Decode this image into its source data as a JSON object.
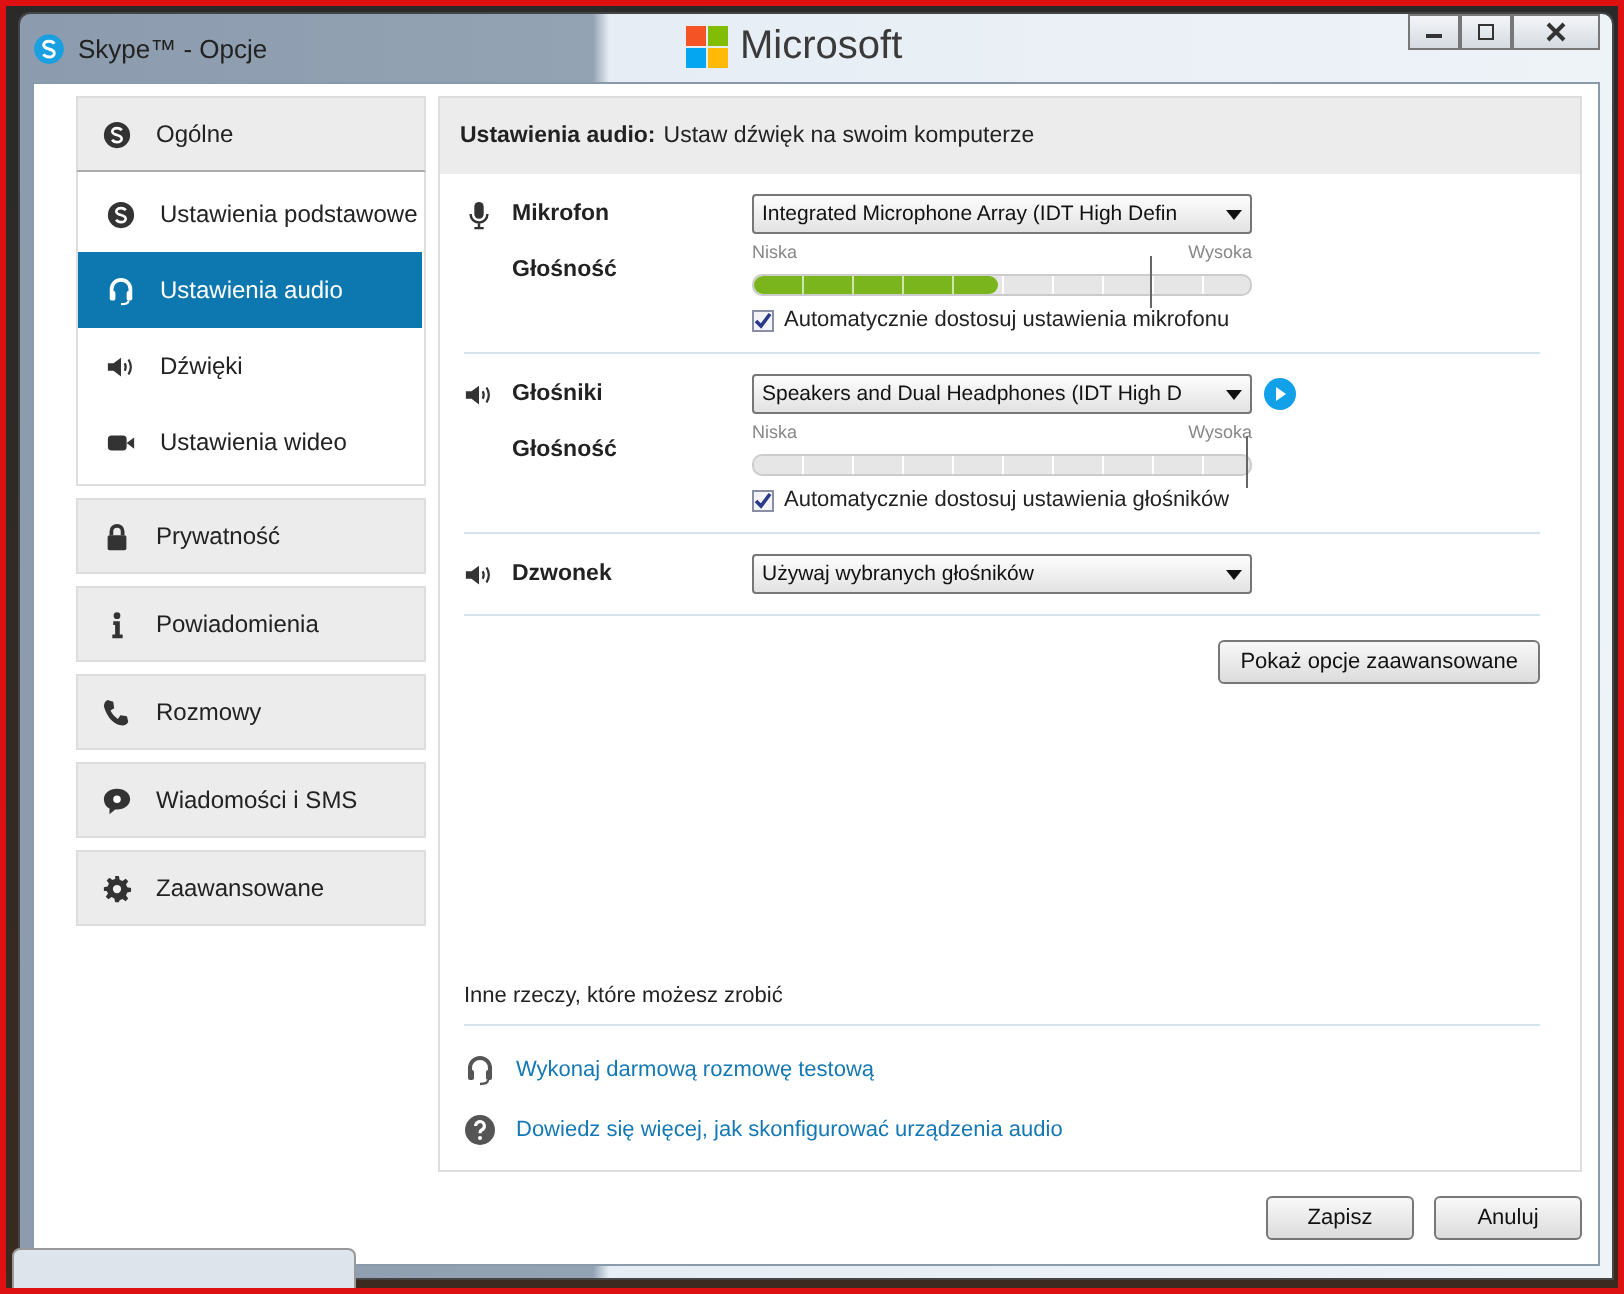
{
  "backdrop": {
    "logo_text": "Microsoft"
  },
  "window": {
    "title": "Skype™ - Opcje"
  },
  "sidebar": {
    "groups": [
      {
        "label": "Ogólne",
        "expanded": true,
        "children": [
          {
            "label": "Ustawienia podstawowe",
            "selected": false
          },
          {
            "label": "Ustawienia audio",
            "selected": true
          },
          {
            "label": "Dźwięki",
            "selected": false
          },
          {
            "label": "Ustawienia wideo",
            "selected": false
          }
        ]
      },
      {
        "label": "Prywatność",
        "expanded": false
      },
      {
        "label": "Powiadomienia",
        "expanded": false
      },
      {
        "label": "Rozmowy",
        "expanded": false
      },
      {
        "label": "Wiadomości i SMS",
        "expanded": false
      },
      {
        "label": "Zaawansowane",
        "expanded": false
      }
    ]
  },
  "header": {
    "title": "Ustawienia audio:",
    "subtitle": "Ustaw dźwięk na swoim komputerze"
  },
  "sections": [
    {
      "label": "Mikrofon",
      "device": "Integrated Microphone Array (IDT High Defin",
      "play_button": false,
      "volume": {
        "label": "Głośność",
        "low": "Niska",
        "high": "Wysoka",
        "meter": {
          "level": 0.49
        },
        "slider": {
          "level": 0.8
        }
      },
      "auto": {
        "label": "Automatycznie dostosuj ustawienia mikrofonu",
        "checked": true
      }
    },
    {
      "label": "Głośniki",
      "device": "Speakers and Dual Headphones (IDT High D",
      "play_button": true,
      "volume": {
        "label": "Głośność",
        "low": "Niska",
        "high": "Wysoka",
        "slider": {
          "level": 0.99
        }
      },
      "auto": {
        "label": "Automatycznie dostosuj ustawienia głośników",
        "checked": true
      }
    },
    {
      "label": "Dzwonek",
      "device": "Używaj wybranych głośników",
      "play_button": false
    }
  ],
  "advanced_button": "Pokaż opcje zaawansowane",
  "other": {
    "title": "Inne rzeczy, które możesz zrobić",
    "links": [
      {
        "label": "Wykonaj darmową rozmowę testową"
      },
      {
        "label": "Dowiedz się więcej, jak skonfigurować urządzenia audio"
      }
    ]
  },
  "buttons": [
    "Zapisz",
    "Anuluj"
  ]
}
